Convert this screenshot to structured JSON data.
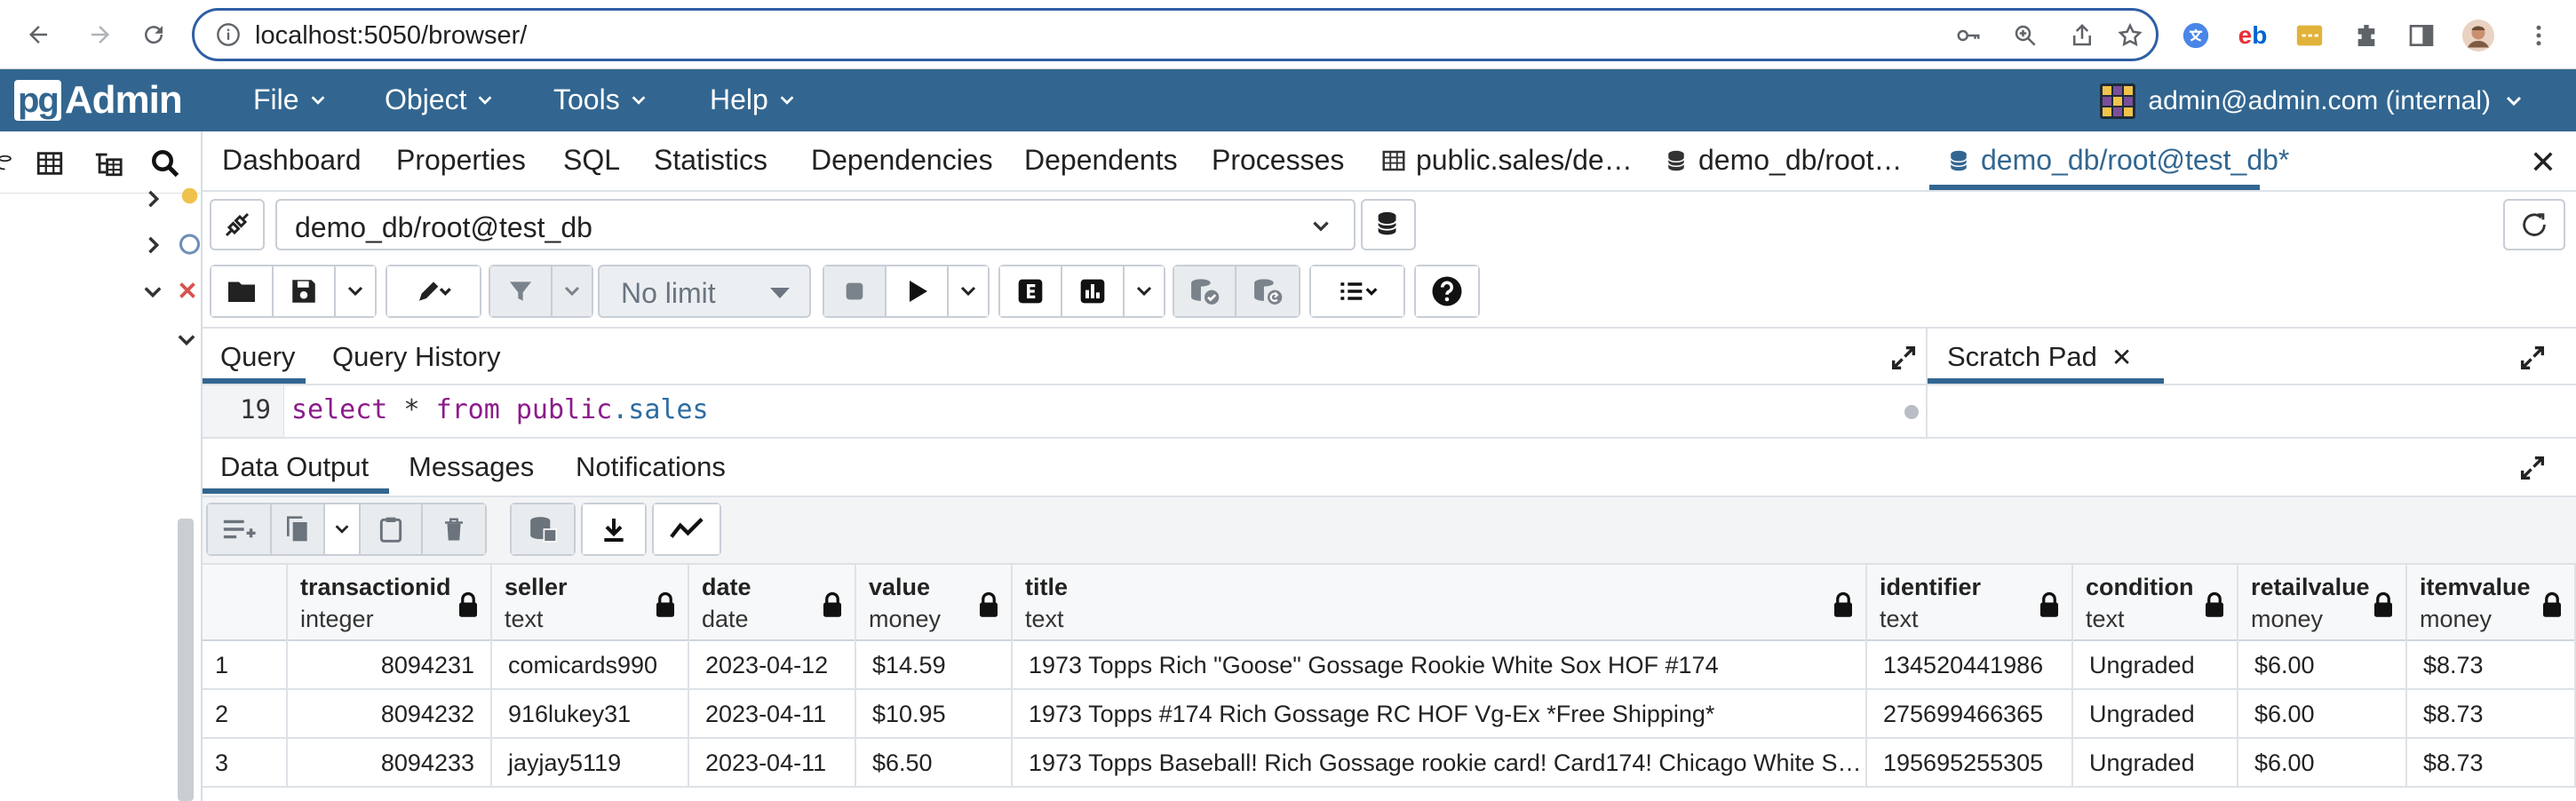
{
  "browser": {
    "url": "localhost:5050/browser/"
  },
  "app": {
    "logo_pg": "pg",
    "logo_admin": "Admin",
    "menus": [
      "File",
      "Object",
      "Tools",
      "Help"
    ],
    "user": "admin@admin.com (internal)"
  },
  "tabs": {
    "items": [
      "Dashboard",
      "Properties",
      "SQL",
      "Statistics",
      "Dependencies",
      "Dependents",
      "Processes",
      "public.sales/de…",
      "demo_db/root…",
      "demo_db/root@test_db*"
    ],
    "close_label": "✕"
  },
  "connection": {
    "value": "demo_db/root@test_db"
  },
  "toolbar": {
    "limit_value": "No limit"
  },
  "query_tabs": {
    "query": "Query",
    "history": "Query History",
    "scratch": "Scratch Pad",
    "scratch_close": "✕"
  },
  "editor": {
    "line_number": "19",
    "kw_select": "select",
    "star": " * ",
    "kw_from": "from",
    "space": " ",
    "schema": "public",
    "dot_table": ".sales"
  },
  "result_tabs": [
    "Data Output",
    "Messages",
    "Notifications"
  ],
  "grid": {
    "columns": [
      {
        "name": "transactionid",
        "type": "integer"
      },
      {
        "name": "seller",
        "type": "text"
      },
      {
        "name": "date",
        "type": "date"
      },
      {
        "name": "value",
        "type": "money"
      },
      {
        "name": "title",
        "type": "text"
      },
      {
        "name": "identifier",
        "type": "text"
      },
      {
        "name": "condition",
        "type": "text"
      },
      {
        "name": "retailvalue",
        "type": "money"
      },
      {
        "name": "itemvalue",
        "type": "money"
      }
    ],
    "rows": [
      [
        "1",
        "8094231",
        "comicards990",
        "2023-04-12",
        "$14.59",
        "1973 Topps Rich \"Goose\" Gossage Rookie White Sox HOF #174",
        "134520441986",
        "Ungraded",
        "$6.00",
        "$8.73"
      ],
      [
        "2",
        "8094232",
        "916lukey31",
        "2023-04-11",
        "$10.95",
        "1973 Topps #174 Rich Gossage RC HOF Vg-Ex *Free Shipping*",
        "275699466365",
        "Ungraded",
        "$6.00",
        "$8.73"
      ],
      [
        "3",
        "8094233",
        "jayjay5119",
        "2023-04-11",
        "$6.50",
        "1973 Topps Baseball! Rich Gossage rookie card! Card174! Chicago White S…",
        "195695255305",
        "Ungraded",
        "$6.00",
        "$8.73"
      ]
    ]
  },
  "colors": {
    "brand": "#326690",
    "accent_active_tab": "#326690",
    "keyword": "#8c1b8a",
    "table_name": "#2d6ca2"
  }
}
